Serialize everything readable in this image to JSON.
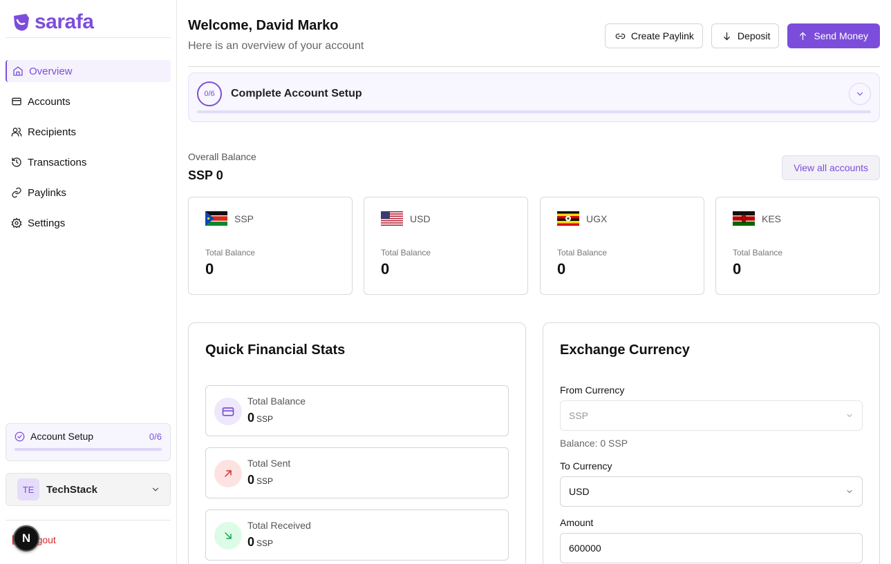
{
  "brand": {
    "name": "sarafa",
    "color": "#7c4ddb"
  },
  "sidebar": {
    "items": [
      {
        "label": "Overview",
        "icon": "home-icon",
        "active": true
      },
      {
        "label": "Accounts",
        "icon": "wallet-icon"
      },
      {
        "label": "Recipients",
        "icon": "users-icon"
      },
      {
        "label": "Transactions",
        "icon": "history-icon"
      },
      {
        "label": "Paylinks",
        "icon": "link-icon"
      },
      {
        "label": "Settings",
        "icon": "gear-icon"
      }
    ],
    "setup": {
      "label": "Account Setup",
      "count": "0/6"
    },
    "org": {
      "initials": "TE",
      "name": "TechStack"
    },
    "logout_label": "Logout",
    "dev_badge": "N"
  },
  "header": {
    "welcome": "Welcome, David Marko",
    "subtitle": "Here is an overview of your account",
    "actions": {
      "create_paylink": "Create Paylink",
      "deposit": "Deposit",
      "send_money": "Send Money"
    }
  },
  "setup_banner": {
    "progress": "0/6",
    "title": "Complete Account Setup"
  },
  "overall": {
    "label": "Overall Balance",
    "value": "SSP 0",
    "view_all": "View all accounts"
  },
  "currencies": [
    {
      "code": "SSP",
      "label": "Total Balance",
      "value": "0"
    },
    {
      "code": "USD",
      "label": "Total Balance",
      "value": "0"
    },
    {
      "code": "UGX",
      "label": "Total Balance",
      "value": "0"
    },
    {
      "code": "KES",
      "label": "Total Balance",
      "value": "0"
    }
  ],
  "stats": {
    "title": "Quick Financial Stats",
    "items": [
      {
        "label": "Total Balance",
        "value": "0",
        "unit": "SSP",
        "icon": "card-icon"
      },
      {
        "label": "Total Sent",
        "value": "0",
        "unit": "SSP",
        "icon": "arrow-up-right-icon"
      },
      {
        "label": "Total Received",
        "value": "0",
        "unit": "SSP",
        "icon": "arrow-down-right-icon"
      }
    ]
  },
  "exchange": {
    "title": "Exchange Currency",
    "from_label": "From Currency",
    "from_value": "SSP",
    "balance_note": "Balance: 0 SSP",
    "to_label": "To Currency",
    "to_value": "USD",
    "amount_label": "Amount",
    "amount_value": "600000"
  }
}
